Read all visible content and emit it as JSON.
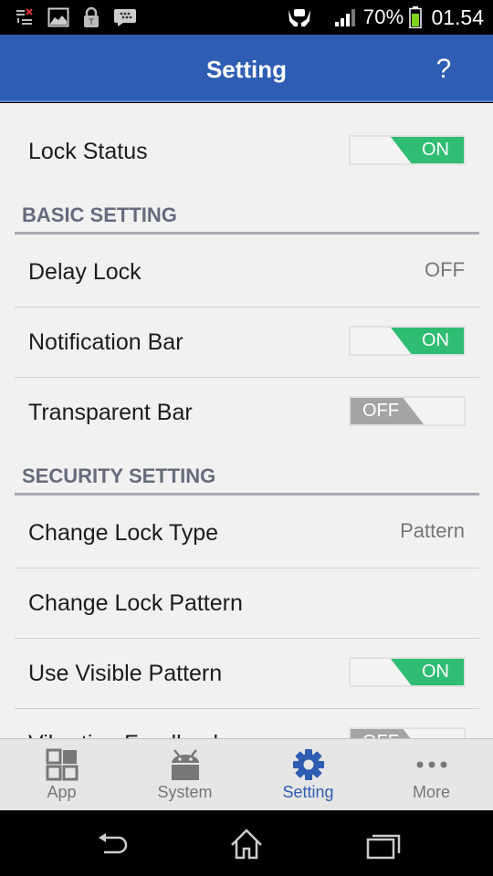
{
  "status_bar": {
    "notification_icons": [
      "task-list-icon",
      "image-icon",
      "lock-icon",
      "bbm-icon"
    ],
    "vpn_icon": "hands-shield-icon",
    "signal_icon": "signal-icon",
    "battery_percent": "70%",
    "battery_icon": "battery-icon",
    "time": "01.54"
  },
  "app_bar": {
    "title": "Setting",
    "help_label": "?"
  },
  "rows": {
    "lock_status": {
      "label": "Lock Status",
      "toggle": "ON"
    },
    "basic_section": "BASIC SETTING",
    "delay_lock": {
      "label": "Delay Lock",
      "value": "OFF"
    },
    "notification_bar": {
      "label": "Notification Bar",
      "toggle": "ON"
    },
    "transparent_bar": {
      "label": "Transparent Bar",
      "toggle": "OFF"
    },
    "security_section": "SECURITY SETTING",
    "change_lock_type": {
      "label": "Change Lock Type",
      "value": "Pattern"
    },
    "change_lock_pattern": {
      "label": "Change Lock Pattern"
    },
    "use_visible_pattern": {
      "label": "Use Visible Pattern",
      "toggle": "ON"
    },
    "vibration_feedback": {
      "label": "Vibration Feedback",
      "toggle": "OFF"
    }
  },
  "tabs": [
    {
      "label": "App",
      "icon": "grid-icon",
      "active": false
    },
    {
      "label": "System",
      "icon": "android-icon",
      "active": false
    },
    {
      "label": "Setting",
      "icon": "gear-icon",
      "active": true
    },
    {
      "label": "More",
      "icon": "more-dots-icon",
      "active": false
    }
  ],
  "nav_bar": {
    "back": "back-icon",
    "home": "home-icon",
    "recents": "recents-icon"
  },
  "colors": {
    "accent": "#2e5db3",
    "toggle_on": "#2ebd72",
    "toggle_off": "#a4a4a4",
    "section_text": "#666b7d"
  }
}
